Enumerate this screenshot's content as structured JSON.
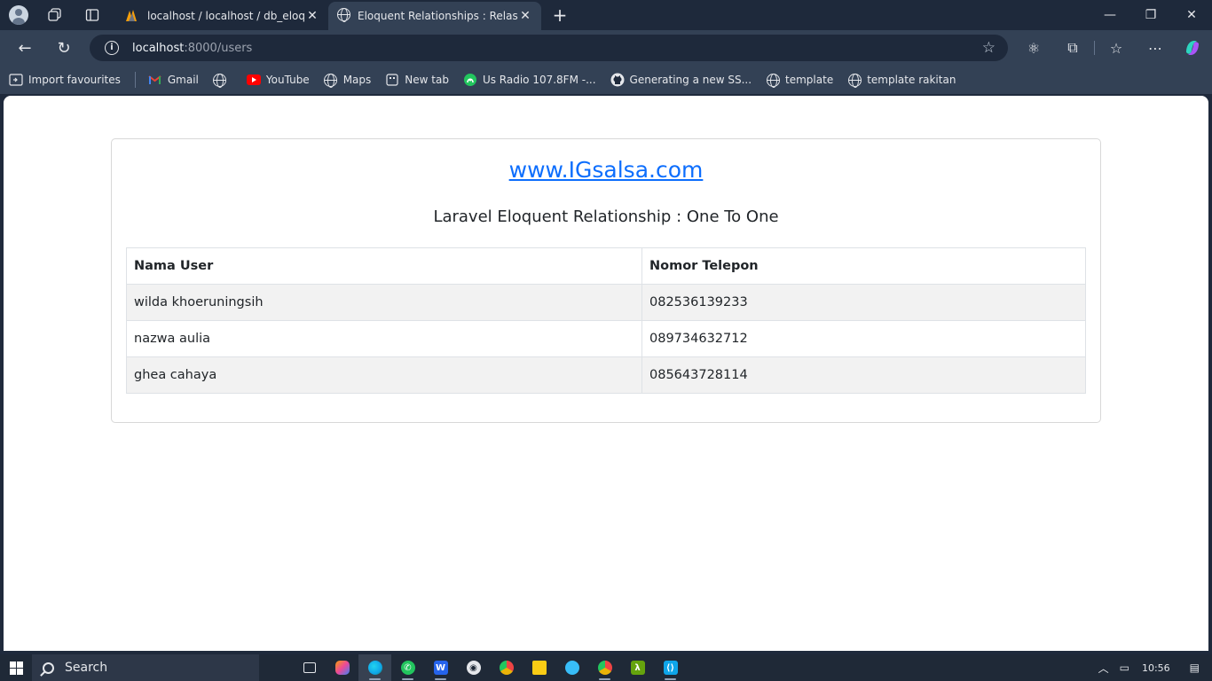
{
  "browser": {
    "tabs": [
      {
        "title": "localhost / localhost / db_eloquer",
        "active": false,
        "icon": "phpmyadmin-icon"
      },
      {
        "title": "Eloquent Relationships : Relasi On",
        "active": true,
        "icon": "globe-icon"
      }
    ],
    "address": {
      "host": "localhost",
      "path": ":8000/users"
    },
    "bookmarks": [
      {
        "label": "Import favourites",
        "icon": "import-icon"
      },
      {
        "label": "Gmail",
        "icon": "gmail-icon"
      },
      {
        "label": "",
        "icon": "globe-icon"
      },
      {
        "label": "YouTube",
        "icon": "youtube-icon"
      },
      {
        "label": "Maps",
        "icon": "globe-icon"
      },
      {
        "label": "New tab",
        "icon": "newtab-icon"
      },
      {
        "label": "Us Radio 107.8FM -...",
        "icon": "radio-icon"
      },
      {
        "label": "Generating a new SS...",
        "icon": "github-icon"
      },
      {
        "label": "template",
        "icon": "globe-icon"
      },
      {
        "label": "template rakitan",
        "icon": "globe-icon"
      }
    ]
  },
  "page": {
    "site_link": "www.IGsalsa.com",
    "heading": "Laravel Eloquent Relationship : One To One",
    "table": {
      "headers": [
        "Nama User",
        "Nomor Telepon"
      ],
      "rows": [
        [
          "wilda khoeruningsih",
          "082536139233"
        ],
        [
          "nazwa aulia",
          "089734632712"
        ],
        [
          "ghea cahaya",
          "085643728114"
        ]
      ]
    }
  },
  "taskbar": {
    "search_label": "Search",
    "clock": "10:56"
  },
  "colors": {
    "link": "#0d6efd",
    "browser_dark": "#1e293b",
    "browser_toolbar": "#334155"
  }
}
